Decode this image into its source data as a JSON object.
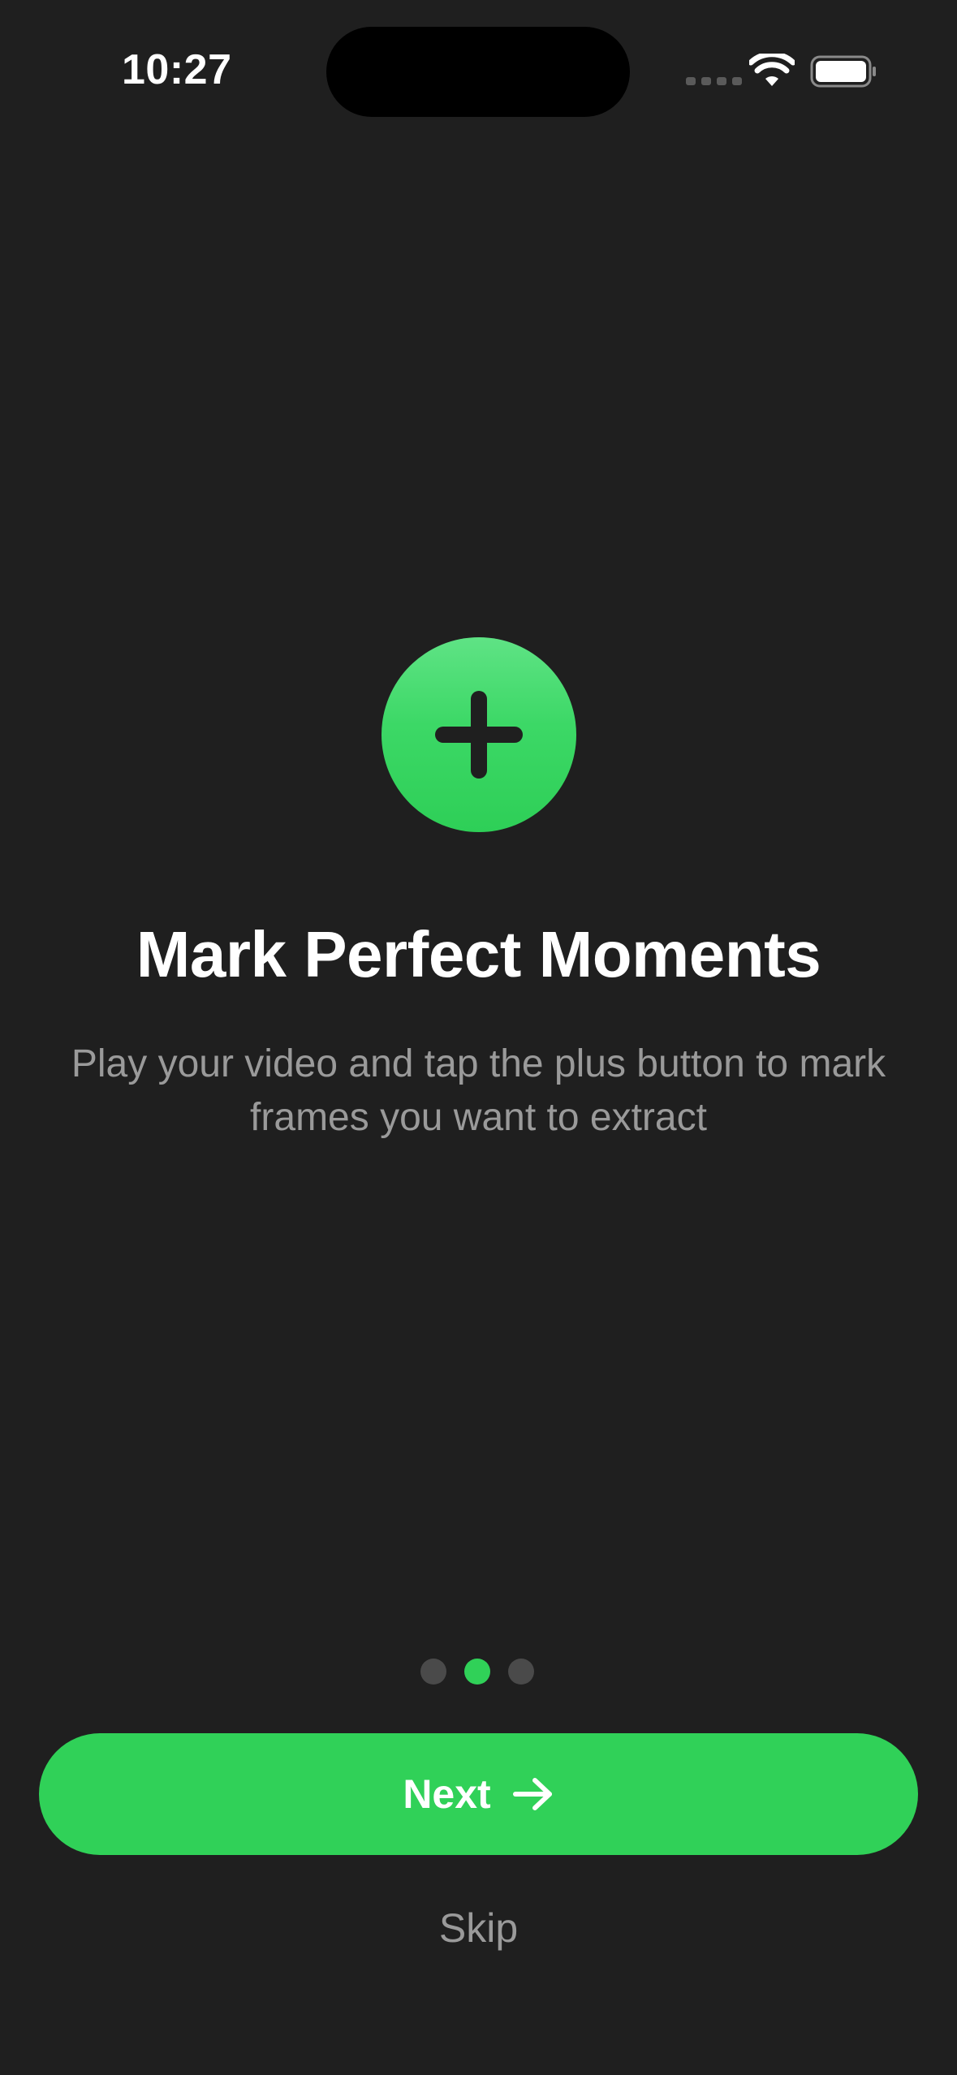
{
  "status_bar": {
    "time": "10:27"
  },
  "onboarding": {
    "icon": "plus-icon",
    "title": "Mark Perfect Moments",
    "description": "Play your video and tap the plus button to mark frames you want to extract",
    "pages": {
      "count": 3,
      "active_index": 1
    },
    "next_label": "Next",
    "next_icon": "arrow-right-icon",
    "skip_label": "Skip"
  },
  "colors": {
    "background": "#1f1f1f",
    "accent": "#30d158",
    "secondary_text": "#9a9a9a",
    "inactive_dot": "#4a4a4a"
  }
}
